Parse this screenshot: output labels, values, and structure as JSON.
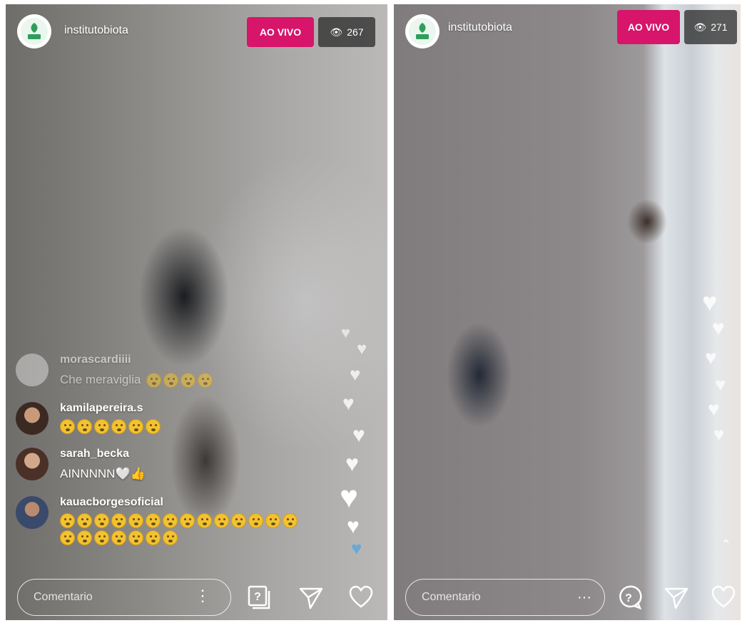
{
  "left": {
    "account": "institutobiota",
    "live_label": "AO VIVO",
    "viewer_count": "267",
    "comments": [
      {
        "user": "morascardiiii",
        "message": "Che meraviglia",
        "emoji_count": 4,
        "faded": true
      },
      {
        "user": "kamilapereira.s",
        "message": "",
        "emoji_count": 6,
        "faded": false
      },
      {
        "user": "sarah_becka",
        "message": "AINNNNN🤍👍",
        "emoji_count": 0,
        "faded": false
      },
      {
        "user": "kauacborgesoficial",
        "message": "",
        "emoji_count": 21,
        "faded": false
      }
    ],
    "comment_placeholder": "Comentario",
    "icons": {
      "more": "more-vertical-icon",
      "question": "question-box-icon",
      "send": "send-icon",
      "like": "heart-outline-icon"
    }
  },
  "right": {
    "account": "institutobiota",
    "live_label": "AO VIVO",
    "viewer_count": "271",
    "comment_placeholder": "Comentario",
    "icons": {
      "more": "more-horizontal-icon",
      "question": "question-bubble-icon",
      "send": "send-icon",
      "like": "heart-outline-icon",
      "scroll": "chevron-up-icon"
    }
  },
  "colors": {
    "live_badge": "#d6156b",
    "viewer_badge": "#232323",
    "biota_green": "#2f9e5b"
  }
}
